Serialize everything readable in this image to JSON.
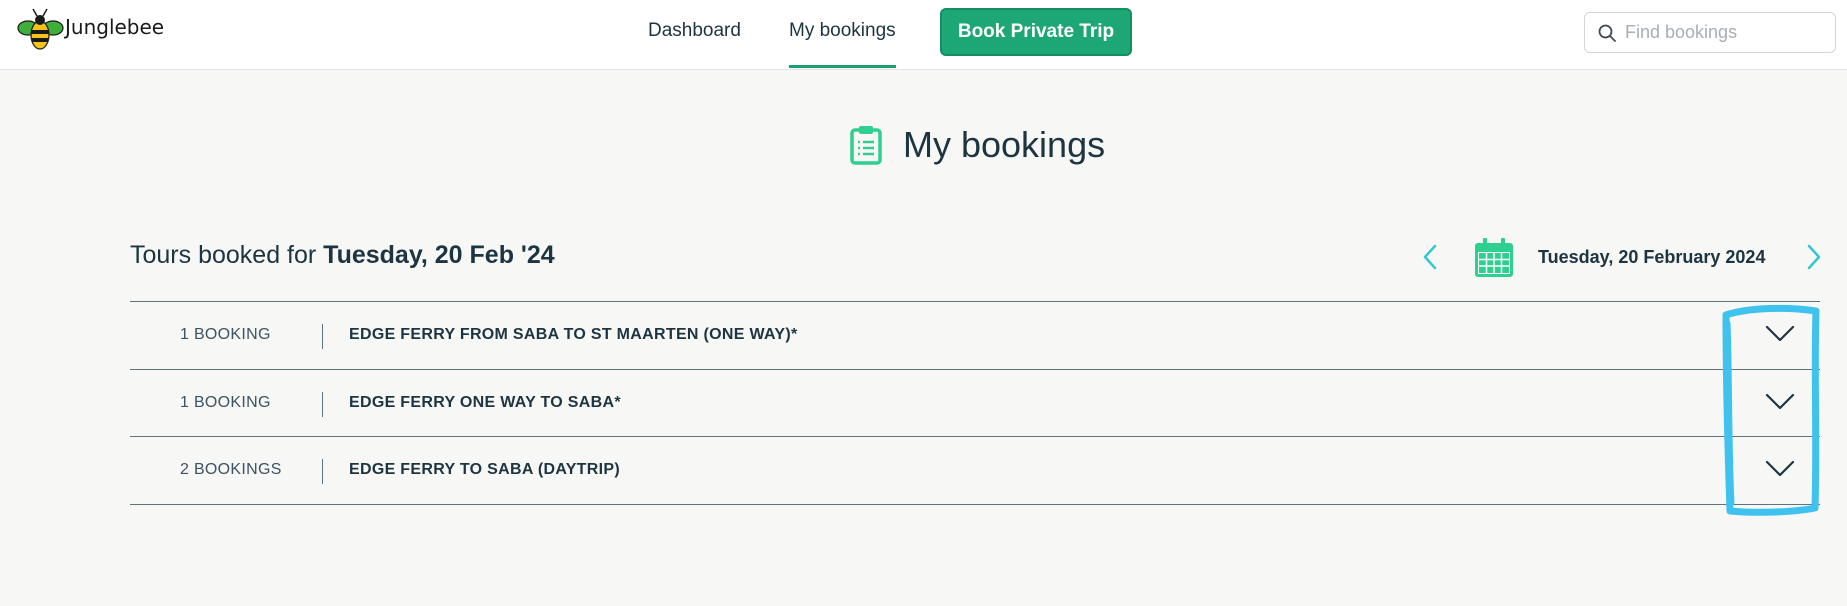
{
  "header": {
    "brand": "Junglebee",
    "nav": {
      "dashboard": "Dashboard",
      "my_bookings": "My bookings"
    },
    "cta": "Book Private Trip",
    "search": {
      "placeholder": "Find bookings",
      "value": ""
    }
  },
  "page": {
    "title": "My bookings",
    "tours_prefix": "Tours booked for ",
    "tours_date": "Tuesday, 20 Feb '24",
    "selected_date": "Tuesday, 20 February 2024"
  },
  "bookings": [
    {
      "count": "1 BOOKING",
      "title": "EDGE FERRY FROM SABA TO ST MAARTEN (ONE WAY)*"
    },
    {
      "count": "1 BOOKING",
      "title": "EDGE FERRY ONE WAY TO SABA*"
    },
    {
      "count": "2 BOOKINGS",
      "title": "EDGE FERRY TO SABA (DAYTRIP)"
    }
  ],
  "colors": {
    "accent": "#1ea776",
    "accent_light": "#2fcf8f",
    "chevron_cyan": "#35c6d6",
    "highlight": "#3fc3ee",
    "text": "#1d3441"
  },
  "icons": [
    "bee-logo-icon",
    "search-icon",
    "clipboard-icon",
    "chevron-left-icon",
    "calendar-icon",
    "chevron-right-icon",
    "chevron-down-icon"
  ]
}
